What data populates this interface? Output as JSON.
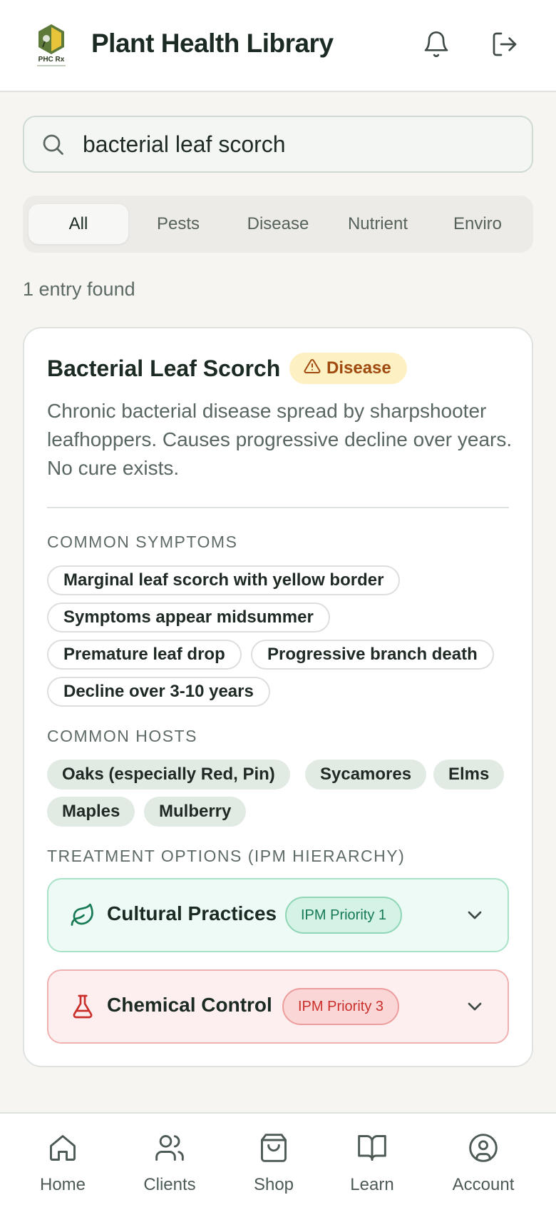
{
  "header": {
    "title": "Plant Health Library",
    "logo_text": "PHC Rx",
    "notification_icon": "bell-icon",
    "logout_icon": "logout-icon"
  },
  "search": {
    "value": "bacterial leaf scorch",
    "icon": "search-icon"
  },
  "filters": {
    "tabs": [
      {
        "label": "All",
        "active": true
      },
      {
        "label": "Pests",
        "active": false
      },
      {
        "label": "Disease",
        "active": false
      },
      {
        "label": "Nutrient",
        "active": false
      },
      {
        "label": "Enviro",
        "active": false
      }
    ]
  },
  "results": {
    "count_text": "1 entry found"
  },
  "entry": {
    "title": "Bacterial Leaf Scorch",
    "category": "Disease",
    "category_icon": "warning-icon",
    "description": "Chronic bacterial disease spread by sharpshooter leafhoppers. Causes progressive decline over years. No cure exists.",
    "symptoms_label": "COMMON SYMPTOMS",
    "symptoms": [
      "Marginal leaf scorch with yellow border",
      "Symptoms appear midsummer",
      "Premature leaf drop",
      "Progressive branch death",
      "Decline over 3-10 years"
    ],
    "hosts_label": "COMMON HOSTS",
    "hosts": [
      "Oaks (especially Red, Pin)",
      "Sycamores",
      "Elms",
      "Maples",
      "Mulberry"
    ],
    "treatments_label": "TREATMENT OPTIONS (IPM HIERARCHY)",
    "treatments": [
      {
        "label": "Cultural Practices",
        "priority": "IPM Priority 1",
        "icon": "leaf-icon",
        "color": "#167a55"
      },
      {
        "label": "Chemical Control",
        "priority": "IPM Priority 3",
        "icon": "flask-icon",
        "color": "#c9302c"
      }
    ]
  },
  "bottom_nav": {
    "items": [
      {
        "label": "Home",
        "icon": "home-icon"
      },
      {
        "label": "Clients",
        "icon": "users-icon"
      },
      {
        "label": "Shop",
        "icon": "shopping-bag-icon"
      },
      {
        "label": "Learn",
        "icon": "book-icon"
      },
      {
        "label": "Account",
        "icon": "account-icon"
      }
    ]
  },
  "colors": {
    "accent_green": "#167a55",
    "danger_red": "#c9302c",
    "disease_badge_bg": "#fdf1c4",
    "background": "#f6f5f2"
  }
}
